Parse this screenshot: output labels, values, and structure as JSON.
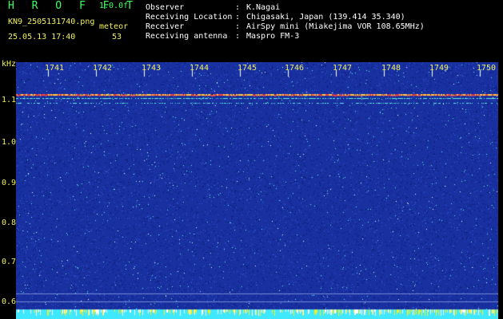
{
  "header": {
    "app_title": "H R O F F T",
    "app_version": "1.0.0f",
    "filename": "KN9_2505131740.png",
    "meteor_label": "meteor",
    "timestamp": "25.05.13 17:40",
    "meteor_count": "53"
  },
  "info": [
    {
      "key": "Observer",
      "value": "K.Nagai"
    },
    {
      "key": "Receiving Location",
      "value": "Chigasaki, Japan (139.414 35.340)"
    },
    {
      "key": "Receiver",
      "value": "AirSpy mini (Miakejima VOR 108.65MHz)"
    },
    {
      "key": "Receiving antenna",
      "value": "Maspro FM-3"
    }
  ],
  "spectrogram": {
    "unit_label": "kHz",
    "y_ticks": [
      "1.1",
      "1.0",
      "0.9",
      "0.8",
      "0.7",
      "0.6"
    ],
    "x_ticks": [
      "1741",
      "1742",
      "1743",
      "1744",
      "1745",
      "1746",
      "1747",
      "1748",
      "1749",
      "1750"
    ],
    "colors": {
      "background": "#1830a0",
      "noise": "#3a5ad8",
      "signal": "#60f0e0",
      "hot": "#ff4040",
      "bottom_band": "#40e8ff"
    }
  }
}
